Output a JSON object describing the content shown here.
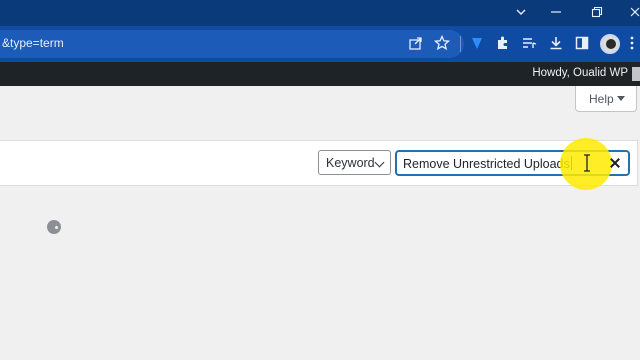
{
  "browser": {
    "url": "&type=term",
    "window_controls": [
      "chevron-down-icon",
      "minimize-icon",
      "restore-icon",
      "close-icon"
    ],
    "toolbar_icons": [
      "share-icon",
      "star-icon",
      "vpn-shield-icon",
      "extensions-icon",
      "media-queue-icon",
      "download-icon",
      "sidebar-icon",
      "profile-avatar",
      "kebab-menu-icon"
    ]
  },
  "adminbar": {
    "greeting": "Howdy, Oualid WP"
  },
  "help": {
    "label": "Help"
  },
  "filter": {
    "type_select": "Keyword",
    "search_value": "Remove Unrestricted Uploads"
  },
  "colors": {
    "titlebar": "#0b3a7a",
    "toolbar": "#0f4aa3",
    "adminbar": "#1d2327",
    "focus": "#2271b1",
    "cursor_highlight": "#ffeb00"
  }
}
